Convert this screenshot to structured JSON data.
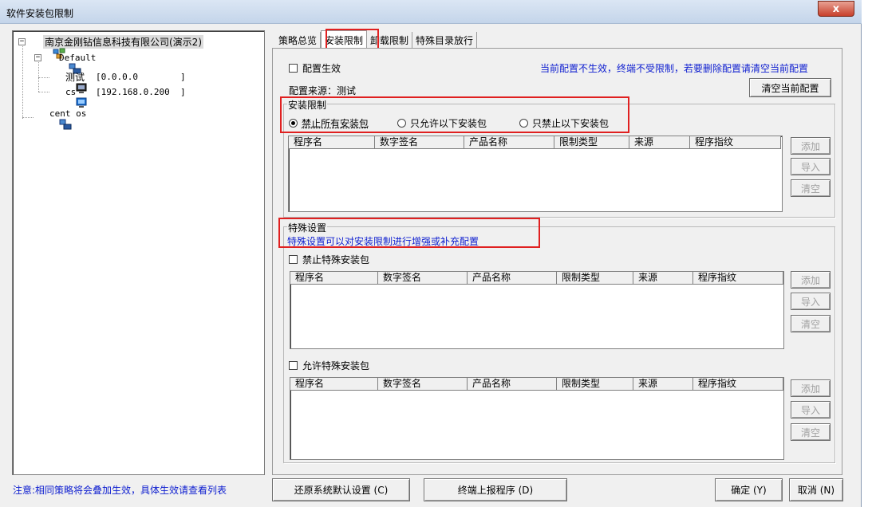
{
  "window": {
    "title": "软件安装包限制",
    "close": "x"
  },
  "tree": {
    "root": {
      "label": "南京金刚钻信息科技有限公司(演示2)",
      "expander": "−"
    },
    "default_group": {
      "label": "Default",
      "expander": "−"
    },
    "hosts": [
      {
        "name": "测试",
        "ip": "[0.0.0.0        ]"
      },
      {
        "name": "cs",
        "ip": "[192.168.0.200  ]"
      }
    ],
    "other_group": {
      "label": "cent os"
    }
  },
  "tabs": [
    "策略总览",
    "安装限制",
    "卸载限制",
    "特殊目录放行"
  ],
  "active_tab": 1,
  "config": {
    "enable_label": "配置生效",
    "warning": "当前配置不生效，终端不受限制，若要删除配置请清空当前配置",
    "source_label": "配置来源：测试",
    "clear_button": "清空当前配置"
  },
  "install_limit": {
    "group_title": "安装限制",
    "options": [
      "禁止所有安装包",
      "只允许以下安装包",
      "只禁止以下安装包"
    ],
    "selected": 0
  },
  "columns": [
    "程序名",
    "数字签名",
    "产品名称",
    "限制类型",
    "来源",
    "程序指纹"
  ],
  "side_buttons": {
    "add": "添加",
    "import": "导入",
    "clear": "清空"
  },
  "special": {
    "group_title": "特殊设置",
    "description": "特殊设置可以对安装限制进行增强或补充配置",
    "forbid_label": "禁止特殊安装包",
    "allow_label": "允许特殊安装包"
  },
  "footer": {
    "note": "注意:相同策略将会叠加生效，具体生效请查看列表",
    "restore": "还原系统默认设置 (C)",
    "report": "终端上报程序 (D)",
    "ok": "确定 (Y)",
    "cancel": "取消 (N)"
  }
}
